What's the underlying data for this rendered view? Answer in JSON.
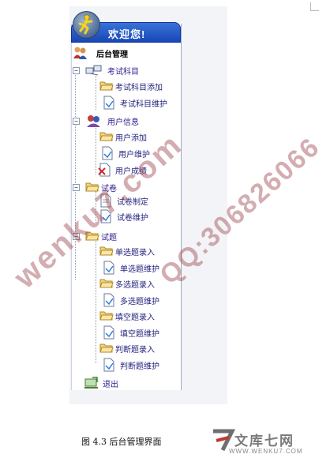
{
  "header": {
    "title": "欢迎您!"
  },
  "tree": {
    "root_label": "后台管理",
    "categories": [
      {
        "label": "考试科目",
        "toggle": "−",
        "items": [
          {
            "label": "考试科目添加"
          },
          {
            "label": "考试科目维护"
          }
        ]
      },
      {
        "label": "用户信息",
        "toggle": "−",
        "items": [
          {
            "label": "用户添加"
          },
          {
            "label": "用户维护"
          },
          {
            "label": "用户成绩"
          }
        ]
      },
      {
        "label": "试卷",
        "toggle": "−",
        "items": [
          {
            "label": "试卷制定"
          },
          {
            "label": "试卷维护"
          }
        ]
      },
      {
        "label": "试题",
        "toggle": "−",
        "items": [
          {
            "label": "单选题录入"
          },
          {
            "label": "单选题维护"
          },
          {
            "label": "多选题录入"
          },
          {
            "label": "多选题维护"
          },
          {
            "label": "填空题录入"
          },
          {
            "label": "填空题维护"
          },
          {
            "label": "判断题录入"
          },
          {
            "label": "判断题维护"
          }
        ]
      }
    ],
    "exit_label": "退出"
  },
  "watermarks": {
    "left": "wenku7.com",
    "right": "QQ:306826066"
  },
  "caption": "图 4.3  后台管理界面",
  "brand": {
    "name": "文库七网",
    "url": "WWW.WENKU7.COM"
  },
  "colors": {
    "header": "#1f52c4",
    "link": "#1a1a6a"
  }
}
